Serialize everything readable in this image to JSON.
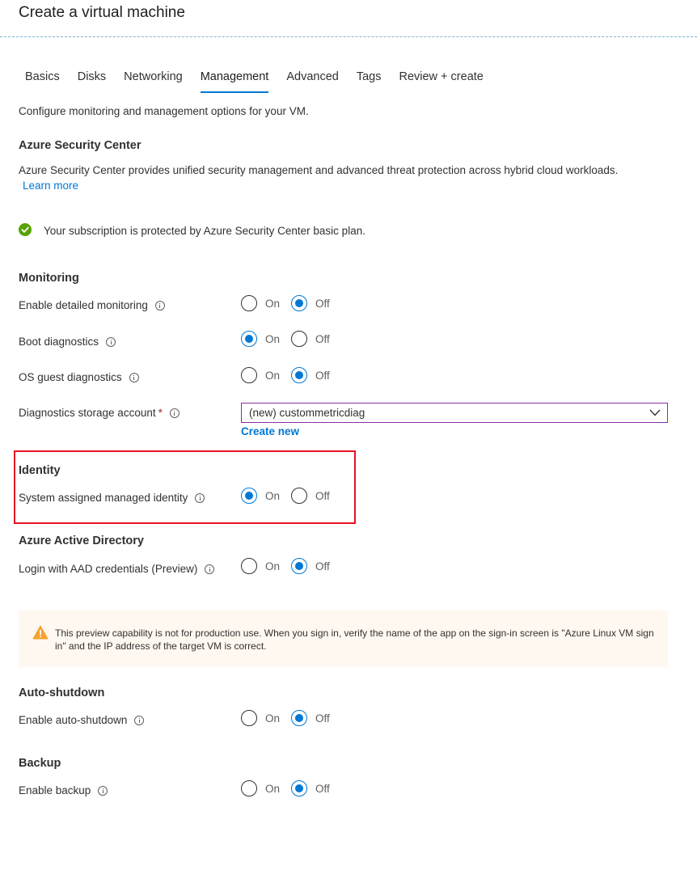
{
  "page": {
    "title": "Create a virtual machine"
  },
  "tabs": [
    {
      "label": "Basics"
    },
    {
      "label": "Disks"
    },
    {
      "label": "Networking"
    },
    {
      "label": "Management",
      "active": true
    },
    {
      "label": "Advanced"
    },
    {
      "label": "Tags"
    },
    {
      "label": "Review + create"
    }
  ],
  "intro": "Configure monitoring and management options for your VM.",
  "security_center": {
    "heading": "Azure Security Center",
    "description": "Azure Security Center provides unified security management and advanced threat protection across hybrid cloud workloads.",
    "learn_more": "Learn more",
    "status_text": "Your subscription is protected by Azure Security Center basic plan.",
    "status_icon": "check-circle-icon",
    "status_color": "#57a300"
  },
  "monitoring": {
    "heading": "Monitoring",
    "detailed_monitoring": {
      "label": "Enable detailed monitoring",
      "selected": "Off"
    },
    "boot_diagnostics": {
      "label": "Boot diagnostics",
      "selected": "On"
    },
    "os_guest_diagnostics": {
      "label": "OS guest diagnostics",
      "selected": "Off"
    },
    "storage_account": {
      "label": "Diagnostics storage account",
      "required_mark": "*",
      "value": "(new) custommetricdiag",
      "create_new": "Create new"
    }
  },
  "identity": {
    "heading": "Identity",
    "system_assigned": {
      "label": "System assigned managed identity",
      "selected": "On"
    }
  },
  "aad": {
    "heading": "Azure Active Directory",
    "login": {
      "label": "Login with AAD credentials (Preview)",
      "selected": "Off"
    },
    "warning": "This preview capability is not for production use.  When you sign in, verify the name of the app on the sign-in screen is \"Azure Linux VM sign in\" and the IP address of the target VM is correct."
  },
  "auto_shutdown": {
    "heading": "Auto-shutdown",
    "enable": {
      "label": "Enable auto-shutdown",
      "selected": "Off"
    }
  },
  "backup": {
    "heading": "Backup",
    "enable": {
      "label": "Enable backup",
      "selected": "Off"
    }
  },
  "options": {
    "on": "On",
    "off": "Off"
  },
  "colors": {
    "accent": "#0078d4",
    "highlight_border": "#e81123",
    "warning_bg": "#fff8f0",
    "warning_icon": "#f7a130",
    "dropdown_border": "#8a2da5"
  }
}
